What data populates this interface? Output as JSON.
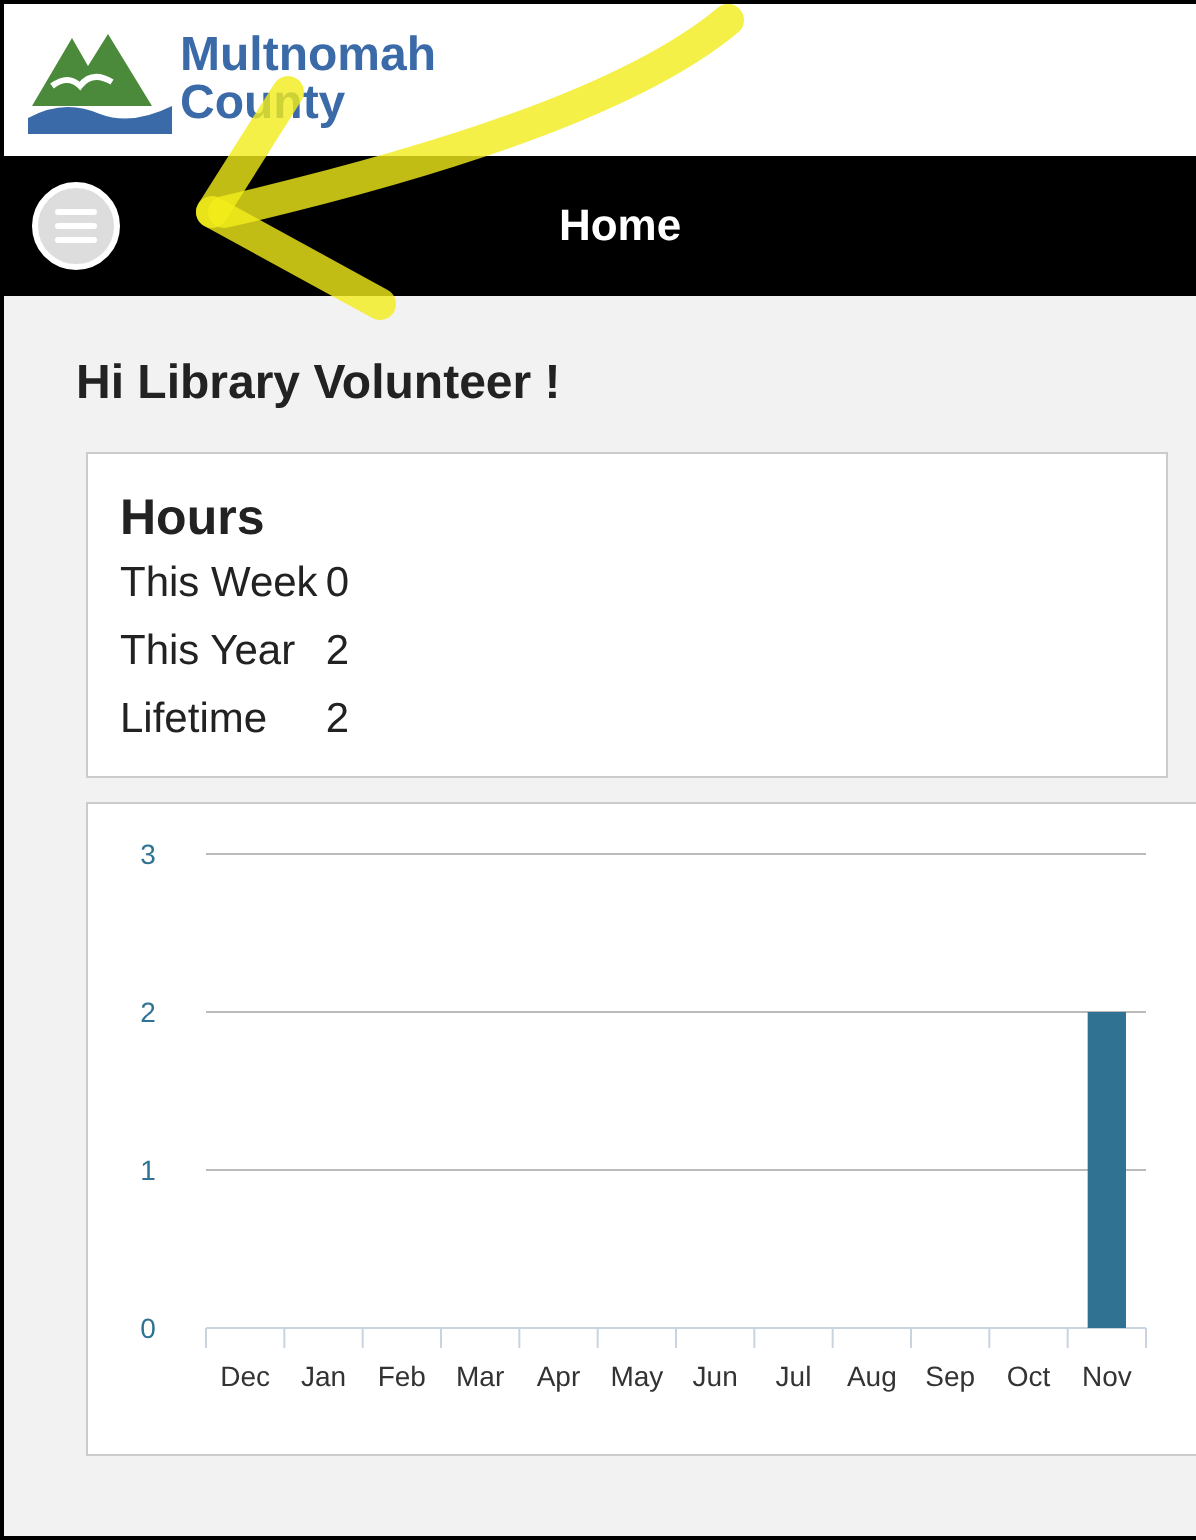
{
  "logo": {
    "lines": [
      "Multnomah",
      "County"
    ]
  },
  "navbar": {
    "title": "Home"
  },
  "greeting": "Hi Library Volunteer !",
  "hours": {
    "title": "Hours",
    "rows": [
      {
        "label": "This Week",
        "value": "0"
      },
      {
        "label": "This Year",
        "value": "2"
      },
      {
        "label": "Lifetime",
        "value": "2"
      }
    ]
  },
  "chart": {
    "chart_data": {
      "type": "bar",
      "categories": [
        "Dec",
        "Jan",
        "Feb",
        "Mar",
        "Apr",
        "May",
        "Jun",
        "Jul",
        "Aug",
        "Sep",
        "Oct",
        "Nov"
      ],
      "series": [
        {
          "color": "#2f7291",
          "values": [
            0,
            0,
            0,
            0,
            0,
            0,
            0,
            0,
            0,
            0,
            0,
            2
          ]
        }
      ],
      "ylim": [
        0,
        3
      ],
      "yticks": [
        0,
        1,
        2,
        3
      ]
    }
  }
}
